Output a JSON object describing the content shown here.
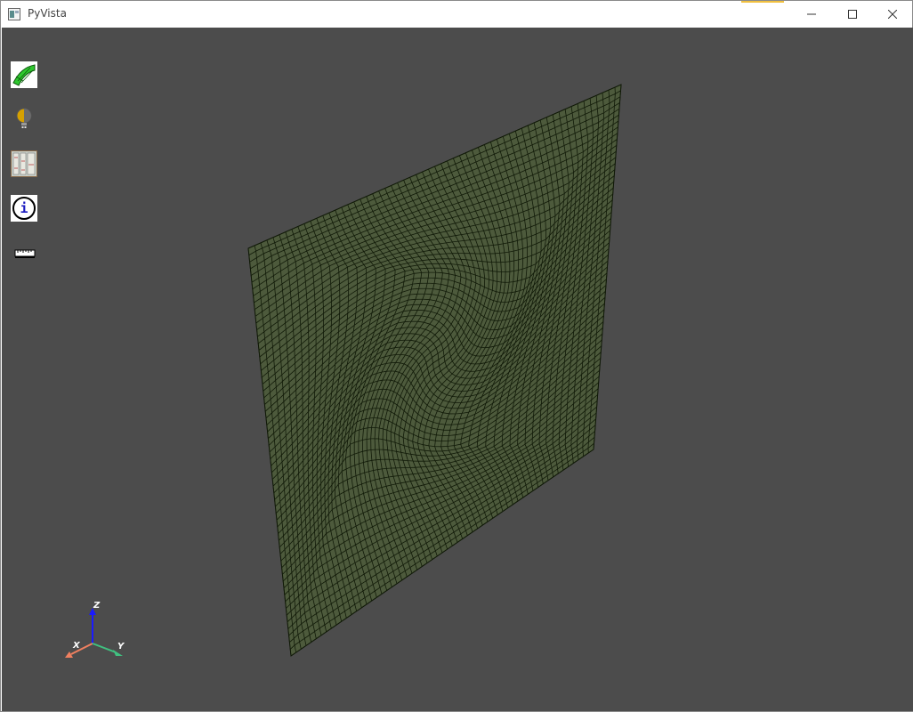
{
  "window": {
    "title": "PyVista",
    "accent_color": "#f0c040",
    "controls": [
      "minimize-icon",
      "maximize-icon",
      "close-icon"
    ]
  },
  "viewport": {
    "background": "#4c4c4c",
    "mesh_fill": "#4d5a3c",
    "mesh_edge": "#111a08"
  },
  "toolbar": {
    "buttons": [
      {
        "name": "mesh-visibility-button",
        "icon": "green-mesh-icon"
      },
      {
        "name": "lighting-button",
        "icon": "lightbulb-icon"
      },
      {
        "name": "bookshelf-button",
        "icon": "bookshelf-icon"
      },
      {
        "name": "info-button",
        "icon": "info-icon"
      },
      {
        "name": "ruler-button",
        "icon": "ruler-icon"
      }
    ]
  },
  "axes": {
    "x_label": "X",
    "y_label": "Y",
    "z_label": "Z",
    "x_color": "#f08060",
    "y_color": "#40c080",
    "z_color": "#1a1aff"
  }
}
